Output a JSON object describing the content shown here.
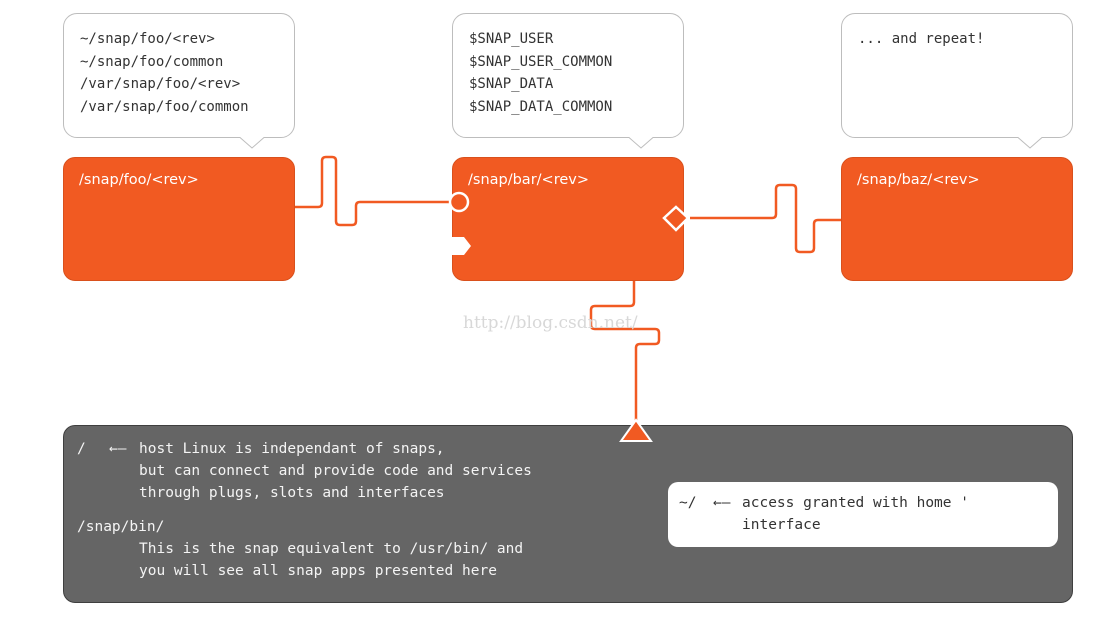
{
  "bubbles": [
    {
      "lines": [
        "~/snap/foo/<rev>",
        "~/snap/foo/common",
        "/var/snap/foo/<rev>",
        "/var/snap/foo/common"
      ]
    },
    {
      "lines": [
        "$SNAP_USER",
        "$SNAP_USER_COMMON",
        "$SNAP_DATA",
        "$SNAP_DATA_COMMON"
      ]
    },
    {
      "lines": [
        "... and repeat!"
      ]
    }
  ],
  "snaps": [
    {
      "label": "/snap/foo/<rev>"
    },
    {
      "label": "/snap/bar/<rev>"
    },
    {
      "label": "/snap/baz/<rev>"
    }
  ],
  "host": {
    "root_path": "/",
    "arrow": "←—",
    "root_desc": [
      "host Linux is independant of snaps,",
      "but can connect and provide code and services",
      "through plugs, slots and interfaces"
    ],
    "bin_path": "/snap/bin/",
    "bin_desc": [
      "This is the snap equivalent to /usr/bin/ and",
      "you will see all snap apps presented here"
    ]
  },
  "home": {
    "path": "~/",
    "arrow": "←—",
    "desc": [
      "access granted with home '",
      "interface"
    ]
  },
  "watermark": "http://blog.csdn.net/",
  "colors": {
    "snap_orange": "#f15a22",
    "host_gray": "#656565",
    "bubble_border": "#bdbdbd"
  }
}
